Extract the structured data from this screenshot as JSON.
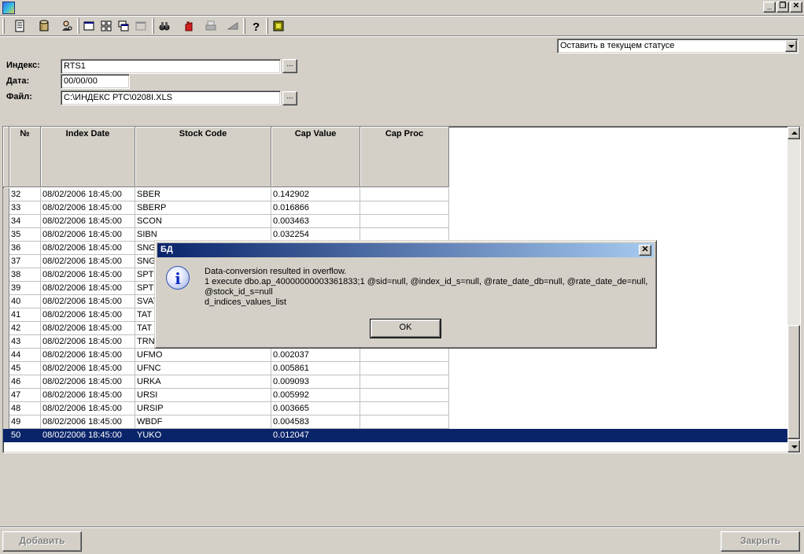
{
  "window": {
    "minimize_label": "_",
    "restore_label": "❐",
    "close_label": "✕"
  },
  "toolbar": {
    "icons": [
      "document-icon",
      "database-icon",
      "user-search-icon",
      "window-icon",
      "grid-icon",
      "cascade-icon",
      "window-disabled-icon",
      "binoculars-icon",
      "stop-hand-icon",
      "printer-icon",
      "send-icon",
      "help-icon",
      "exit-icon"
    ]
  },
  "status_select": {
    "value": "Оставить в текущем статусе"
  },
  "form": {
    "index_label": "Индекс:",
    "index_value": "RTS1",
    "date_label": "Дата:",
    "date_value": "00/00/00",
    "file_label": "Файл:",
    "file_value": "C:\\ИНДЕКС РТС\\0208I.XLS",
    "browse_label": "..."
  },
  "grid": {
    "columns": [
      "№",
      "Index Date",
      "Stock Code",
      "Cap Value",
      "Cap Proc"
    ],
    "rows": [
      [
        "32",
        "08/02/2006 18:45:00",
        "SBER",
        "0.142902",
        ""
      ],
      [
        "33",
        "08/02/2006 18:45:00",
        "SBERP",
        "0.016866",
        ""
      ],
      [
        "34",
        "08/02/2006 18:45:00",
        "SCON",
        "0.003463",
        ""
      ],
      [
        "35",
        "08/02/2006 18:45:00",
        "SIBN",
        "0.032254",
        ""
      ],
      [
        "36",
        "08/02/2006 18:45:00",
        "SNG",
        "",
        ""
      ],
      [
        "37",
        "08/02/2006 18:45:00",
        "SNG",
        "",
        ""
      ],
      [
        "38",
        "08/02/2006 18:45:00",
        "SPT",
        "",
        ""
      ],
      [
        "39",
        "08/02/2006 18:45:00",
        "SPT",
        "",
        ""
      ],
      [
        "40",
        "08/02/2006 18:45:00",
        "SVAT",
        "",
        ""
      ],
      [
        "41",
        "08/02/2006 18:45:00",
        "TAT",
        "",
        ""
      ],
      [
        "42",
        "08/02/2006 18:45:00",
        "TAT",
        "",
        ""
      ],
      [
        "43",
        "08/02/2006 18:45:00",
        "TRN",
        "",
        ""
      ],
      [
        "44",
        "08/02/2006 18:45:00",
        "UFMO",
        "0.002037",
        ""
      ],
      [
        "45",
        "08/02/2006 18:45:00",
        "UFNC",
        "0.005861",
        ""
      ],
      [
        "46",
        "08/02/2006 18:45:00",
        "URKA",
        "0.009093",
        ""
      ],
      [
        "47",
        "08/02/2006 18:45:00",
        "URSI",
        "0.005992",
        ""
      ],
      [
        "48",
        "08/02/2006 18:45:00",
        "URSIP",
        "0.003665",
        ""
      ],
      [
        "49",
        "08/02/2006 18:45:00",
        "WBDF",
        "0.004583",
        ""
      ],
      [
        "50",
        "08/02/2006 18:45:00",
        "YUKO",
        "0.012047",
        ""
      ]
    ],
    "selected_row": 18
  },
  "buttons": {
    "add_label": "Добавить",
    "close_label": "Закрыть"
  },
  "dialog": {
    "title": "БД",
    "close_label": "✕",
    "icon_glyph": "i",
    "message_lines": [
      "Data-conversion resulted in overflow.",
      "1 execute dbo.ap_40000000003361833;1 @sid=null, @index_id_s=null, @rate_date_db=null, @rate_date_de=null,",
      "@stock_id_s=null",
      "d_indices_values_list"
    ],
    "ok_label": "OK"
  },
  "colors": {
    "face": "#d4d0c8",
    "selection": "#0a246a",
    "title_gradient_start": "#0a246a",
    "title_gradient_end": "#a6caf0"
  }
}
